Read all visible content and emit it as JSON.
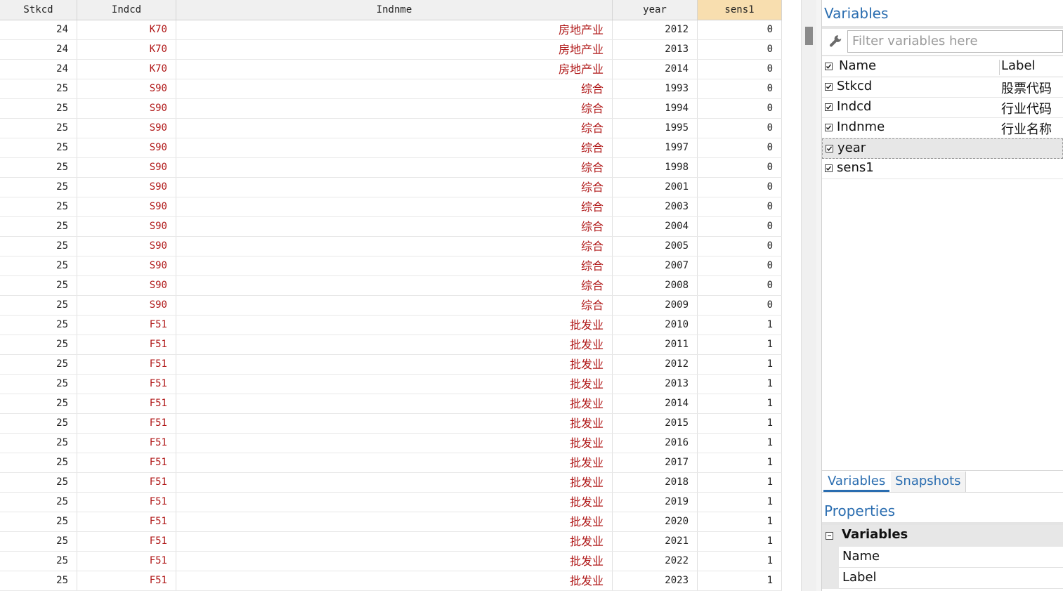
{
  "grid": {
    "columns": [
      "Stkcd",
      "Indcd",
      "Indnme",
      "year",
      "sens1"
    ],
    "selected_column": "sens1",
    "rows": [
      [
        "24",
        "K70",
        "房地产业",
        "2012",
        "0"
      ],
      [
        "24",
        "K70",
        "房地产业",
        "2013",
        "0"
      ],
      [
        "24",
        "K70",
        "房地产业",
        "2014",
        "0"
      ],
      [
        "25",
        "S90",
        "综合",
        "1993",
        "0"
      ],
      [
        "25",
        "S90",
        "综合",
        "1994",
        "0"
      ],
      [
        "25",
        "S90",
        "综合",
        "1995",
        "0"
      ],
      [
        "25",
        "S90",
        "综合",
        "1997",
        "0"
      ],
      [
        "25",
        "S90",
        "综合",
        "1998",
        "0"
      ],
      [
        "25",
        "S90",
        "综合",
        "2001",
        "0"
      ],
      [
        "25",
        "S90",
        "综合",
        "2003",
        "0"
      ],
      [
        "25",
        "S90",
        "综合",
        "2004",
        "0"
      ],
      [
        "25",
        "S90",
        "综合",
        "2005",
        "0"
      ],
      [
        "25",
        "S90",
        "综合",
        "2007",
        "0"
      ],
      [
        "25",
        "S90",
        "综合",
        "2008",
        "0"
      ],
      [
        "25",
        "S90",
        "综合",
        "2009",
        "0"
      ],
      [
        "25",
        "F51",
        "批发业",
        "2010",
        "1"
      ],
      [
        "25",
        "F51",
        "批发业",
        "2011",
        "1"
      ],
      [
        "25",
        "F51",
        "批发业",
        "2012",
        "1"
      ],
      [
        "25",
        "F51",
        "批发业",
        "2013",
        "1"
      ],
      [
        "25",
        "F51",
        "批发业",
        "2014",
        "1"
      ],
      [
        "25",
        "F51",
        "批发业",
        "2015",
        "1"
      ],
      [
        "25",
        "F51",
        "批发业",
        "2016",
        "1"
      ],
      [
        "25",
        "F51",
        "批发业",
        "2017",
        "1"
      ],
      [
        "25",
        "F51",
        "批发业",
        "2018",
        "1"
      ],
      [
        "25",
        "F51",
        "批发业",
        "2019",
        "1"
      ],
      [
        "25",
        "F51",
        "批发业",
        "2020",
        "1"
      ],
      [
        "25",
        "F51",
        "批发业",
        "2021",
        "1"
      ],
      [
        "25",
        "F51",
        "批发业",
        "2022",
        "1"
      ],
      [
        "25",
        "F51",
        "批发业",
        "2023",
        "1"
      ]
    ]
  },
  "variables_panel": {
    "title": "Variables",
    "filter_placeholder": "Filter variables here",
    "header": {
      "name": "Name",
      "label": "Label"
    },
    "items": [
      {
        "name": "Stkcd",
        "label": "股票代码",
        "checked": true
      },
      {
        "name": "Indcd",
        "label": "行业代码",
        "checked": true
      },
      {
        "name": "Indnme",
        "label": "行业名称",
        "checked": true
      },
      {
        "name": "year",
        "label": "",
        "checked": true,
        "selected": true
      },
      {
        "name": "sens1",
        "label": "",
        "checked": true
      }
    ]
  },
  "tabs": {
    "variables": "Variables",
    "snapshots": "Snapshots"
  },
  "properties_panel": {
    "title": "Properties",
    "group": "Variables",
    "rows": [
      "Name",
      "Label"
    ]
  },
  "colors": {
    "string_value": "#b01818",
    "accent": "#2a6db0",
    "selected_column_header": "#f8deaf"
  }
}
